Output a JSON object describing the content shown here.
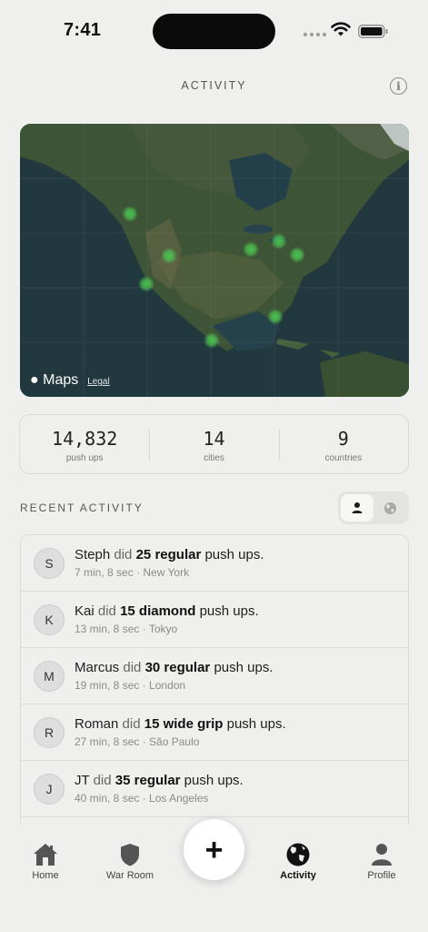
{
  "status_bar": {
    "time": "7:41"
  },
  "header": {
    "title": "ACTIVITY",
    "info_glyph": "i"
  },
  "map": {
    "brand": "Maps",
    "legal": "Legal",
    "marker_color": "#4cc552"
  },
  "stats": [
    {
      "value": "14,832",
      "label": "push ups"
    },
    {
      "value": "14",
      "label": "cities"
    },
    {
      "value": "9",
      "label": "countries"
    }
  ],
  "recent": {
    "title": "RECENT ACTIVITY",
    "filter_icons": [
      "person-icon",
      "globe-icon"
    ],
    "items": [
      {
        "avatar": "S",
        "name": "Steph",
        "verb": "did",
        "count": "25",
        "variation": "regular",
        "suffix": "push ups.",
        "time": "7 min, 8 sec",
        "location": "New York"
      },
      {
        "avatar": "K",
        "name": "Kai",
        "verb": "did",
        "count": "15",
        "variation": "diamond",
        "suffix": "push ups.",
        "time": "13 min, 8 sec",
        "location": "Tokyo"
      },
      {
        "avatar": "M",
        "name": "Marcus",
        "verb": "did",
        "count": "30",
        "variation": "regular",
        "suffix": "push ups.",
        "time": "19 min, 8 sec",
        "location": "London"
      },
      {
        "avatar": "R",
        "name": "Roman",
        "verb": "did",
        "count": "15",
        "variation": "wide grip",
        "suffix": "push ups.",
        "time": "27 min, 8 sec",
        "location": "São Paulo"
      },
      {
        "avatar": "J",
        "name": "JT",
        "verb": "did",
        "count": "35",
        "variation": "regular",
        "suffix": "push ups.",
        "time": "40 min, 8 sec",
        "location": "Los Angeles"
      }
    ]
  },
  "tabs": {
    "home": "Home",
    "war_room": "War Room",
    "add": "+",
    "activity": "Activity",
    "profile": "Profile"
  }
}
